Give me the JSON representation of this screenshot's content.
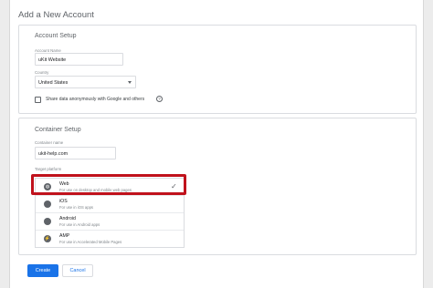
{
  "page": {
    "title": "Add a New Account"
  },
  "account_setup": {
    "title": "Account Setup",
    "account_name_label": "Account Name",
    "account_name_value": "uKit Website",
    "country_label": "Country",
    "country_value": "United States",
    "share_data_label": "Share data anonymously with Google and others",
    "share_data_checked": false
  },
  "container_setup": {
    "title": "Container Setup",
    "container_name_label": "Container name",
    "container_name_value": "ukit-help.com",
    "target_platform_label": "Target platform",
    "platforms": [
      {
        "name": "Web",
        "desc": "For use on desktop and mobile web pages",
        "icon": "globe-icon",
        "selected": true
      },
      {
        "name": "iOS",
        "desc": "For use in iOS apps",
        "icon": "apple-icon",
        "selected": false
      },
      {
        "name": "Android",
        "desc": "For use in Android apps",
        "icon": "android-icon",
        "selected": false
      },
      {
        "name": "AMP",
        "desc": "For use in Accelerated Mobile Pages",
        "icon": "amp-icon",
        "selected": false
      }
    ]
  },
  "actions": {
    "create_label": "Create",
    "cancel_label": "Cancel"
  },
  "colors": {
    "accent": "#1a73e8",
    "highlight": "#c0121c"
  }
}
